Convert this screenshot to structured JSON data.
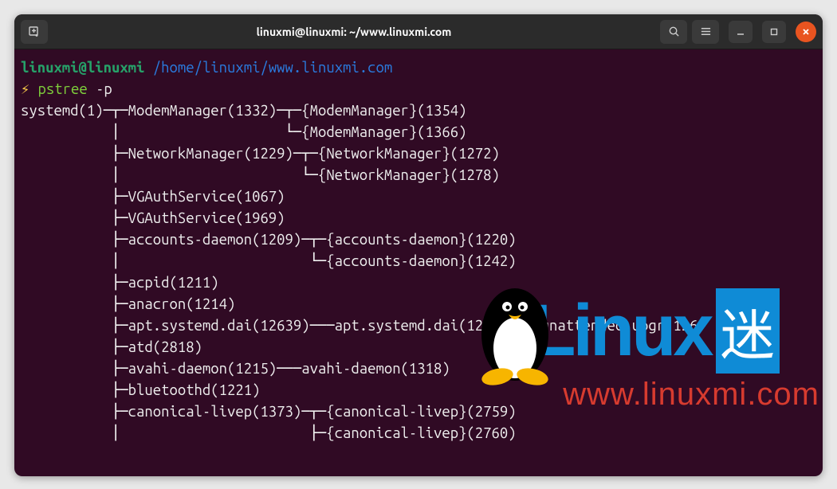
{
  "window": {
    "title": "linuxmi@linuxmi: ~/www.linuxmi.com"
  },
  "prompt": {
    "user": "linuxmi@linuxmi",
    "path": "/home/linuxmi/www.linuxmi.com",
    "bolt": "⚡",
    "command": "pstree",
    "args": "-p"
  },
  "output": "systemd(1)─┬─ModemManager(1332)─┬─{ModemManager}(1354)\n           │                    └─{ModemManager}(1366)\n           ├─NetworkManager(1229)─┬─{NetworkManager}(1272)\n           │                      └─{NetworkManager}(1278)\n           ├─VGAuthService(1067)\n           ├─VGAuthService(1969)\n           ├─accounts-daemon(1209)─┬─{accounts-daemon}(1220)\n           │                       └─{accounts-daemon}(1242)\n           ├─acpid(1211)\n           ├─anacron(1214)\n           ├─apt.systemd.dai(12639)───apt.systemd.dai(12643)───unattended-upgr(126+\n           ├─atd(2818)\n           ├─avahi-daemon(1215)───avahi-daemon(1318)\n           ├─bluetoothd(1221)\n           ├─canonical-livep(1373)─┬─{canonical-livep}(2759)\n           │                       ├─{canonical-livep}(2760)",
  "watermark": {
    "logo_text": "Linux",
    "cn": "迷",
    "url": "www.linuxmi.com"
  },
  "icons": {
    "newtab": "new-tab-icon",
    "search": "search-icon",
    "menu": "hamburger-icon",
    "minimize": "minimize-icon",
    "maximize": "maximize-icon",
    "close": "close-icon"
  }
}
